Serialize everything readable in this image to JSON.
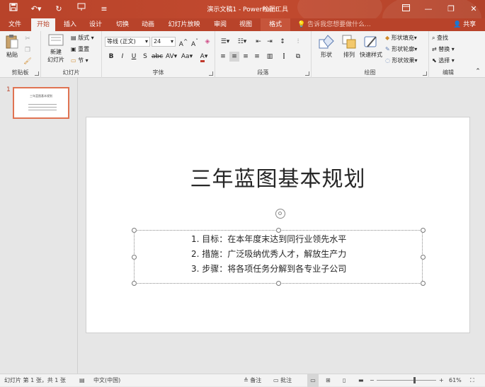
{
  "app": {
    "document_title": "演示文稿1 - PowerPoint",
    "contextual_title": "绘图工具"
  },
  "colors": {
    "accent": "#b8432a",
    "ribbon_bg": "#f3f3f3",
    "selected_thumb_border": "#e07352"
  },
  "tabs": [
    {
      "label": "文件"
    },
    {
      "label": "开始"
    },
    {
      "label": "插入"
    },
    {
      "label": "设计"
    },
    {
      "label": "切换"
    },
    {
      "label": "动画"
    },
    {
      "label": "幻灯片放映"
    },
    {
      "label": "审阅"
    },
    {
      "label": "视图"
    },
    {
      "label": "格式"
    }
  ],
  "tellme_placeholder": "告诉我您想要做什么...",
  "share_label": "共享",
  "ribbon": {
    "clipboard": {
      "label": "剪贴板",
      "paste": "粘贴"
    },
    "slides": {
      "label": "幻灯片",
      "new_slide": "新建",
      "new_slide2": "幻灯片",
      "layout": "版式",
      "reset": "重置",
      "section": "节"
    },
    "font": {
      "label": "字体",
      "font_name": "等线 (正文)",
      "font_size": "24"
    },
    "paragraph": {
      "label": "段落"
    },
    "drawing": {
      "label": "绘图",
      "shape": "形状",
      "arrange": "排列",
      "quick_styles": "快速样式",
      "fill": "形状填充",
      "outline": "形状轮廓",
      "effects": "形状效果"
    },
    "editing": {
      "label": "编辑",
      "find": "查找",
      "replace": "替换",
      "select": "选择"
    }
  },
  "thumbnail": {
    "number": "1"
  },
  "slide": {
    "title": "三年蓝图基本规划",
    "bullets": [
      "1. 目标：在本年度末达到同行业领先水平",
      "2. 措施：广泛吸纳优秀人才，解放生产力",
      "3. 步骤：将各项任务分解到各专业子公司"
    ]
  },
  "status": {
    "slide_info": "幻灯片 第 1 张，共 1 张",
    "language": "中文(中国)",
    "notes": "备注",
    "comments": "批注",
    "zoom": "61%"
  }
}
